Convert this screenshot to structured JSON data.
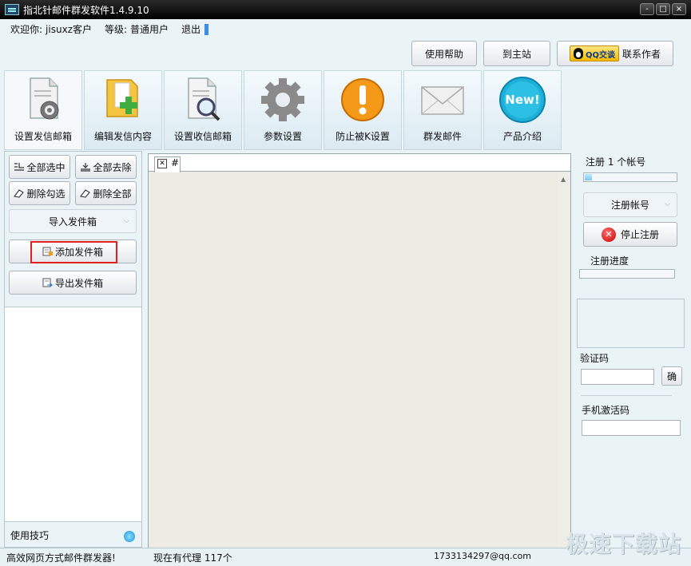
{
  "window": {
    "title": "指北针邮件群发软件1.4.9.10",
    "controls": [
      "-",
      "□",
      "×"
    ]
  },
  "welcome": {
    "greeting": "欢迎你:",
    "username": "jisuxz客户",
    "level_label": "等级:",
    "level": "普通用户",
    "logout": "退出"
  },
  "top_buttons": {
    "help": "使用帮助",
    "home": "到主站",
    "qq_badge": "QQ交谈",
    "contact": "联系作者"
  },
  "tabs": [
    {
      "label": "设置发信邮箱",
      "icon": "document-gear-icon"
    },
    {
      "label": "编辑发信内容",
      "icon": "folder-add-icon"
    },
    {
      "label": "设置收信邮箱",
      "icon": "document-search-icon"
    },
    {
      "label": "参数设置",
      "icon": "gear-icon"
    },
    {
      "label": "防止被K设置",
      "icon": "warning-icon"
    },
    {
      "label": "群发邮件",
      "icon": "envelope-icon"
    },
    {
      "label": "产品介绍",
      "icon": "new-badge-icon"
    }
  ],
  "left_panel": {
    "select_all": "全部选中",
    "deselect_all": "全部去除",
    "delete_checked": "删除勾选",
    "delete_all": "删除全部",
    "import": "导入发件箱",
    "add": "添加发件箱",
    "export": "导出发件箱",
    "tips": "使用技巧"
  },
  "center_panel": {
    "tab_label": "#"
  },
  "right_panel": {
    "register_count": "注册 1 个帐号",
    "register_button": "注册帐号",
    "stop_button": "停止注册",
    "progress_label": "注册进度",
    "captcha_label": "验证码",
    "confirm_button": "确",
    "phone_code_label": "手机激活码"
  },
  "status_bar": {
    "slogan": "高效网页方式邮件群发器!",
    "proxy": "现在有代理 117个",
    "email": "1733134297@qq.com"
  },
  "watermark": "极速下载站"
}
